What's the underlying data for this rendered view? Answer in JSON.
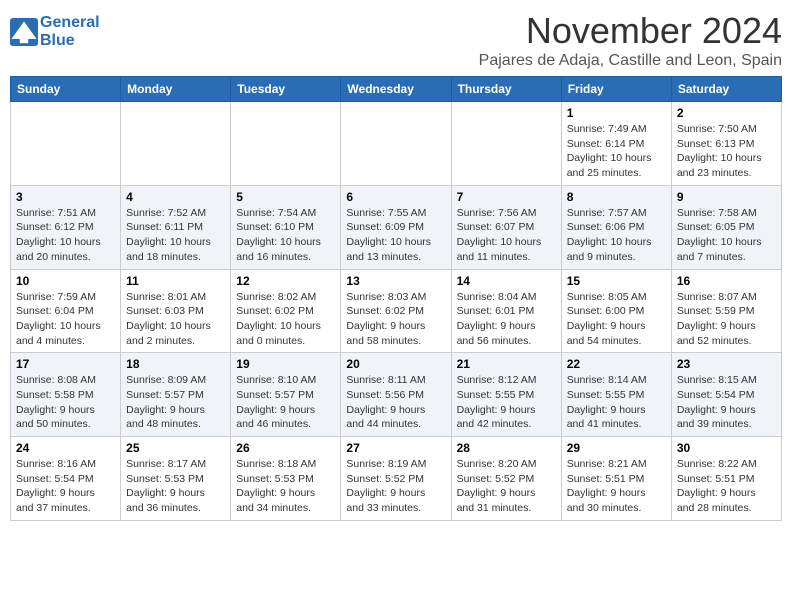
{
  "header": {
    "logo_line1": "General",
    "logo_line2": "Blue",
    "month": "November 2024",
    "location": "Pajares de Adaja, Castille and Leon, Spain"
  },
  "days_of_week": [
    "Sunday",
    "Monday",
    "Tuesday",
    "Wednesday",
    "Thursday",
    "Friday",
    "Saturday"
  ],
  "weeks": [
    [
      {
        "day": "",
        "info": ""
      },
      {
        "day": "",
        "info": ""
      },
      {
        "day": "",
        "info": ""
      },
      {
        "day": "",
        "info": ""
      },
      {
        "day": "",
        "info": ""
      },
      {
        "day": "1",
        "info": "Sunrise: 7:49 AM\nSunset: 6:14 PM\nDaylight: 10 hours and 25 minutes."
      },
      {
        "day": "2",
        "info": "Sunrise: 7:50 AM\nSunset: 6:13 PM\nDaylight: 10 hours and 23 minutes."
      }
    ],
    [
      {
        "day": "3",
        "info": "Sunrise: 7:51 AM\nSunset: 6:12 PM\nDaylight: 10 hours and 20 minutes."
      },
      {
        "day": "4",
        "info": "Sunrise: 7:52 AM\nSunset: 6:11 PM\nDaylight: 10 hours and 18 minutes."
      },
      {
        "day": "5",
        "info": "Sunrise: 7:54 AM\nSunset: 6:10 PM\nDaylight: 10 hours and 16 minutes."
      },
      {
        "day": "6",
        "info": "Sunrise: 7:55 AM\nSunset: 6:09 PM\nDaylight: 10 hours and 13 minutes."
      },
      {
        "day": "7",
        "info": "Sunrise: 7:56 AM\nSunset: 6:07 PM\nDaylight: 10 hours and 11 minutes."
      },
      {
        "day": "8",
        "info": "Sunrise: 7:57 AM\nSunset: 6:06 PM\nDaylight: 10 hours and 9 minutes."
      },
      {
        "day": "9",
        "info": "Sunrise: 7:58 AM\nSunset: 6:05 PM\nDaylight: 10 hours and 7 minutes."
      }
    ],
    [
      {
        "day": "10",
        "info": "Sunrise: 7:59 AM\nSunset: 6:04 PM\nDaylight: 10 hours and 4 minutes."
      },
      {
        "day": "11",
        "info": "Sunrise: 8:01 AM\nSunset: 6:03 PM\nDaylight: 10 hours and 2 minutes."
      },
      {
        "day": "12",
        "info": "Sunrise: 8:02 AM\nSunset: 6:02 PM\nDaylight: 10 hours and 0 minutes."
      },
      {
        "day": "13",
        "info": "Sunrise: 8:03 AM\nSunset: 6:02 PM\nDaylight: 9 hours and 58 minutes."
      },
      {
        "day": "14",
        "info": "Sunrise: 8:04 AM\nSunset: 6:01 PM\nDaylight: 9 hours and 56 minutes."
      },
      {
        "day": "15",
        "info": "Sunrise: 8:05 AM\nSunset: 6:00 PM\nDaylight: 9 hours and 54 minutes."
      },
      {
        "day": "16",
        "info": "Sunrise: 8:07 AM\nSunset: 5:59 PM\nDaylight: 9 hours and 52 minutes."
      }
    ],
    [
      {
        "day": "17",
        "info": "Sunrise: 8:08 AM\nSunset: 5:58 PM\nDaylight: 9 hours and 50 minutes."
      },
      {
        "day": "18",
        "info": "Sunrise: 8:09 AM\nSunset: 5:57 PM\nDaylight: 9 hours and 48 minutes."
      },
      {
        "day": "19",
        "info": "Sunrise: 8:10 AM\nSunset: 5:57 PM\nDaylight: 9 hours and 46 minutes."
      },
      {
        "day": "20",
        "info": "Sunrise: 8:11 AM\nSunset: 5:56 PM\nDaylight: 9 hours and 44 minutes."
      },
      {
        "day": "21",
        "info": "Sunrise: 8:12 AM\nSunset: 5:55 PM\nDaylight: 9 hours and 42 minutes."
      },
      {
        "day": "22",
        "info": "Sunrise: 8:14 AM\nSunset: 5:55 PM\nDaylight: 9 hours and 41 minutes."
      },
      {
        "day": "23",
        "info": "Sunrise: 8:15 AM\nSunset: 5:54 PM\nDaylight: 9 hours and 39 minutes."
      }
    ],
    [
      {
        "day": "24",
        "info": "Sunrise: 8:16 AM\nSunset: 5:54 PM\nDaylight: 9 hours and 37 minutes."
      },
      {
        "day": "25",
        "info": "Sunrise: 8:17 AM\nSunset: 5:53 PM\nDaylight: 9 hours and 36 minutes."
      },
      {
        "day": "26",
        "info": "Sunrise: 8:18 AM\nSunset: 5:53 PM\nDaylight: 9 hours and 34 minutes."
      },
      {
        "day": "27",
        "info": "Sunrise: 8:19 AM\nSunset: 5:52 PM\nDaylight: 9 hours and 33 minutes."
      },
      {
        "day": "28",
        "info": "Sunrise: 8:20 AM\nSunset: 5:52 PM\nDaylight: 9 hours and 31 minutes."
      },
      {
        "day": "29",
        "info": "Sunrise: 8:21 AM\nSunset: 5:51 PM\nDaylight: 9 hours and 30 minutes."
      },
      {
        "day": "30",
        "info": "Sunrise: 8:22 AM\nSunset: 5:51 PM\nDaylight: 9 hours and 28 minutes."
      }
    ]
  ]
}
